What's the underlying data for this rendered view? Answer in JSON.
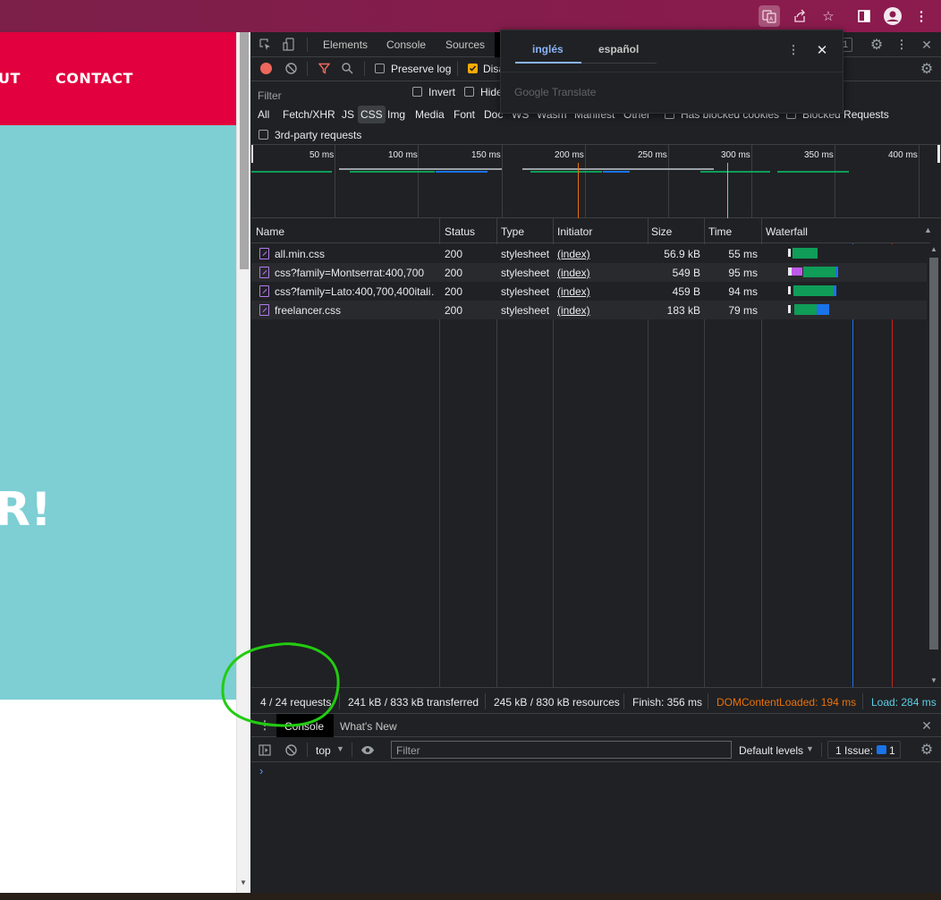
{
  "colors": {
    "browser_bar": "#8c1b4e",
    "site_nav": "#e2003e",
    "hero": "#7dcfd4",
    "devtools_bg": "#202124",
    "waterfall_green": "#0f9d58",
    "waterfall_blue": "#1a73e8",
    "domcontentloaded": "#e8710a",
    "load": "#5ccfe6",
    "annotation": "#22cc11"
  },
  "browser": {
    "icons": [
      "translate-icon",
      "share-icon",
      "star-icon",
      "sidepanel-icon",
      "profile-icon",
      "menu-icon"
    ]
  },
  "site": {
    "nav_partial": "UT",
    "nav_contact": "CONTACT",
    "hero_partial": "R!"
  },
  "devtools": {
    "tabs": [
      "Elements",
      "Console",
      "Sources"
    ],
    "issues_count": "1",
    "toolbar": {
      "preserve_log": "Preserve log",
      "disable_cache": "Disa"
    },
    "filter": {
      "placeholder": "Filter",
      "invert": "Invert",
      "hide": "Hide",
      "types": [
        "All",
        "Fetch/XHR",
        "JS",
        "CSS",
        "Img",
        "Media",
        "Font",
        "Doc",
        "WS",
        "Wasm",
        "Manifest",
        "Other"
      ],
      "active_type": "CSS",
      "blocked_cookies": "Has blocked cookies",
      "blocked_requests": "Blocked Requests",
      "third_party": "3rd-party requests"
    },
    "overview_ticks": [
      "50 ms",
      "100 ms",
      "150 ms",
      "200 ms",
      "250 ms",
      "300 ms",
      "350 ms",
      "400 ms"
    ],
    "columns": [
      "Name",
      "Status",
      "Type",
      "Initiator",
      "Size",
      "Time",
      "Waterfall"
    ],
    "requests": [
      {
        "name": "all.min.css",
        "status": "200",
        "type": "stylesheet",
        "initiator": "(index)",
        "size": "56.9 kB",
        "time": "55 ms"
      },
      {
        "name": "css?family=Montserrat:400,700",
        "status": "200",
        "type": "stylesheet",
        "initiator": "(index)",
        "size": "549 B",
        "time": "95 ms"
      },
      {
        "name": "css?family=Lato:400,700,400itali…",
        "status": "200",
        "type": "stylesheet",
        "initiator": "(index)",
        "size": "459 B",
        "time": "94 ms"
      },
      {
        "name": "freelancer.css",
        "status": "200",
        "type": "stylesheet",
        "initiator": "(index)",
        "size": "183 kB",
        "time": "79 ms"
      }
    ],
    "status": {
      "requests": "4 / 24 requests",
      "transferred": "241 kB / 833 kB transferred",
      "resources": "245 kB / 830 kB resources",
      "finish": "Finish: 356 ms",
      "dcl": "DOMContentLoaded: 194 ms",
      "load": "Load: 284 ms"
    },
    "drawer": {
      "tabs": [
        "Console",
        "What's New"
      ],
      "context": "top",
      "filter_placeholder": "Filter",
      "levels": "Default levels",
      "issues": "1 Issue:",
      "issues_count": "1",
      "prompt": "›"
    }
  },
  "translate_popup": {
    "lang_from": "inglés",
    "lang_to": "español",
    "brand": "Google Translate"
  }
}
